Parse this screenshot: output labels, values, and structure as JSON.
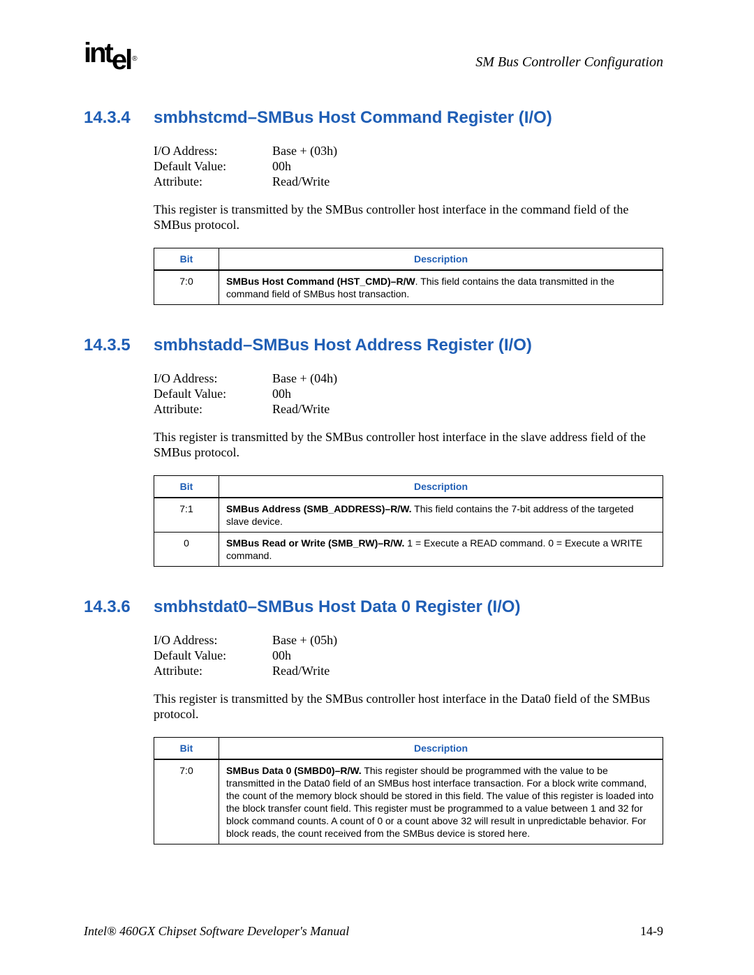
{
  "header": {
    "logo_text": "intel",
    "logo_reg": "®",
    "chapter": "SM Bus Controller Configuration"
  },
  "footer": {
    "manual": "Intel® 460GX Chipset Software Developer's Manual",
    "page": "14-9"
  },
  "sections": [
    {
      "number": "14.3.4",
      "title": "smbhstcmd–SMBus Host Command Register (I/O)",
      "attrs": [
        {
          "label": "I/O Address:",
          "value": "Base + (03h)"
        },
        {
          "label": "Default Value:",
          "value": "00h"
        },
        {
          "label": "Attribute:",
          "value": "Read/Write"
        }
      ],
      "para": "This register is transmitted by the SMBus controller host interface in the command field of the SMBus protocol.",
      "rows": [
        {
          "bit": "7:0",
          "desc_bold": "SMBus Host Command (HST_CMD)–R/W",
          "desc_rest": ". This field contains the data transmitted in the command field of SMBus host transaction."
        }
      ]
    },
    {
      "number": "14.3.5",
      "title": "smbhstadd–SMBus Host Address Register (I/O)",
      "attrs": [
        {
          "label": "I/O Address:",
          "value": "Base + (04h)"
        },
        {
          "label": "Default Value:",
          "value": "00h"
        },
        {
          "label": "Attribute:",
          "value": "Read/Write"
        }
      ],
      "para": "This register is transmitted by the SMBus controller host interface in the slave address field of the SMBus protocol.",
      "rows": [
        {
          "bit": "7:1",
          "desc_bold": "SMBus Address (SMB_ADDRESS)–R/W.",
          "desc_rest": " This field contains the 7-bit address of the targeted slave device."
        },
        {
          "bit": "0",
          "desc_bold": "SMBus Read or Write (SMB_RW)–R/W.",
          "desc_rest": " 1 = Execute a READ command. 0 = Execute a WRITE command."
        }
      ]
    },
    {
      "number": "14.3.6",
      "title": "smbhstdat0–SMBus Host Data 0 Register (I/O)",
      "attrs": [
        {
          "label": "I/O Address:",
          "value": "Base + (05h)"
        },
        {
          "label": "Default Value:",
          "value": "00h"
        },
        {
          "label": "Attribute:",
          "value": "Read/Write"
        }
      ],
      "para": "This register is transmitted by the SMBus controller host interface in the Data0 field of the SMBus protocol.",
      "rows": [
        {
          "bit": "7:0",
          "desc_bold": "SMBus Data 0 (SMBD0)–R/W.",
          "desc_rest": " This register should be programmed with the value to be transmitted in the Data0 field of an SMBus host interface transaction. For a block write command, the count of the memory block should be stored in this field. The value of this register is loaded into the block transfer count field. This register must be programmed to a value between 1 and 32 for block command counts. A count of 0 or a count above 32 will result in unpredictable behavior. For block reads, the count received from the SMBus device is stored here."
        }
      ]
    }
  ],
  "table_headers": {
    "bit": "Bit",
    "desc": "Description"
  }
}
